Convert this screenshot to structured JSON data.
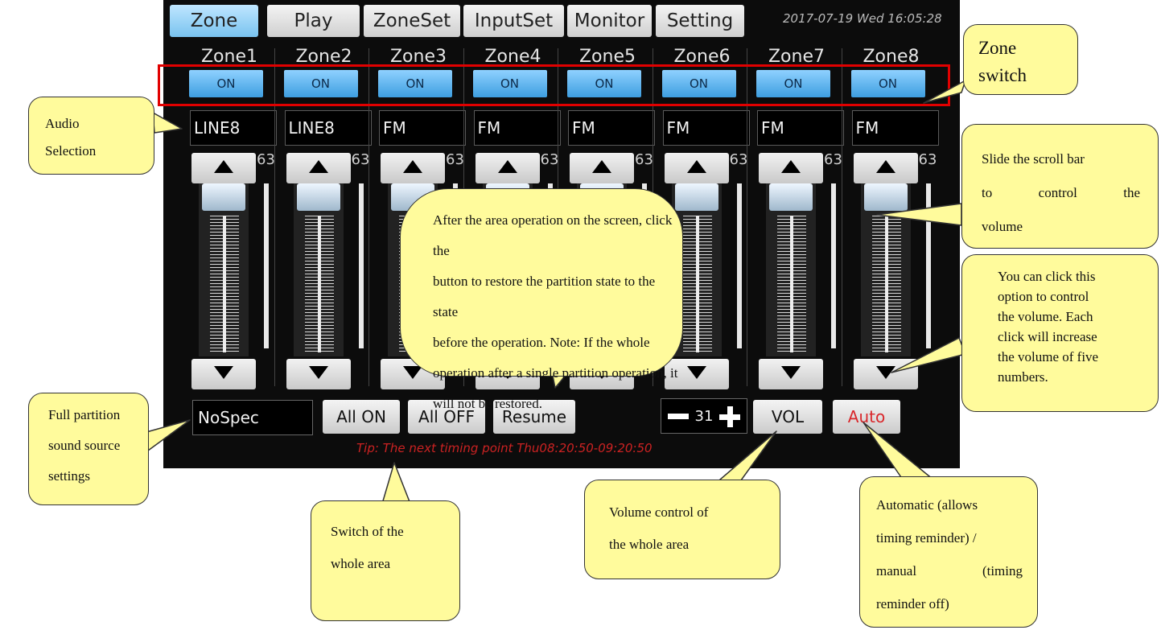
{
  "tabs": [
    {
      "label": "Zone",
      "active": true
    },
    {
      "label": "Play",
      "active": false
    },
    {
      "label": "ZoneSet",
      "active": false
    },
    {
      "label": "InputSet",
      "active": false
    },
    {
      "label": "Monitor",
      "active": false
    },
    {
      "label": "Setting",
      "active": false
    }
  ],
  "clock": "2017-07-19 Wed 16:05:28",
  "zones": [
    {
      "name": "Zone1",
      "switch": "ON",
      "source": "LINE8",
      "volume": "63"
    },
    {
      "name": "Zone2",
      "switch": "ON",
      "source": "LINE8",
      "volume": "63"
    },
    {
      "name": "Zone3",
      "switch": "ON",
      "source": "FM",
      "volume": "63"
    },
    {
      "name": "Zone4",
      "switch": "ON",
      "source": "FM",
      "volume": "63"
    },
    {
      "name": "Zone5",
      "switch": "ON",
      "source": "FM",
      "volume": "63"
    },
    {
      "name": "Zone6",
      "switch": "ON",
      "source": "FM",
      "volume": "63"
    },
    {
      "name": "Zone7",
      "switch": "ON",
      "source": "FM",
      "volume": "63"
    },
    {
      "name": "Zone8",
      "switch": "ON",
      "source": "FM",
      "volume": "63"
    }
  ],
  "bottom": {
    "source": "NoSpec",
    "all_on": "All ON",
    "all_off": "All OFF",
    "resume": "Resume",
    "master_volume": "31",
    "vol": "VOL",
    "auto": "Auto",
    "tip": "Tip: The next timing point Thu08:20:50-09:20:50"
  },
  "icons": {
    "up": "triangle-up-icon",
    "down": "triangle-down-icon",
    "minus": "minus-icon",
    "plus": "plus-icon"
  },
  "colors": {
    "tab_active": "#79c3ef",
    "on_button": "#3d9ee0",
    "highlight_box": "#e10000",
    "tip_text": "#cc2222",
    "callout_fill": "#fffb9c"
  },
  "callouts": {
    "zone_switch": [
      "Zone",
      "switch"
    ],
    "audio_selection": [
      "Audio",
      "Selection"
    ],
    "scroll_bar": [
      "Slide the scroll bar",
      "to control the",
      "volume"
    ],
    "restore": [
      "After the area operation on the screen, click the",
      "button to restore the partition state to the state",
      "before the operation. Note: If the whole",
      "operation after a single partition operation, it",
      "will not be restored."
    ],
    "click_option": [
      "You can click this",
      "option to control",
      "the volume. Each",
      "click will increase",
      "the volume of five",
      "numbers."
    ],
    "full_partition": [
      "Full partition",
      "sound source",
      "settings"
    ],
    "switch_area": [
      "Switch of the",
      "whole area"
    ],
    "volume_area": [
      "Volume control of",
      "the whole area"
    ],
    "automatic": [
      "Automatic (allows",
      "timing reminder) /",
      "manual (timing",
      "reminder off)"
    ]
  }
}
